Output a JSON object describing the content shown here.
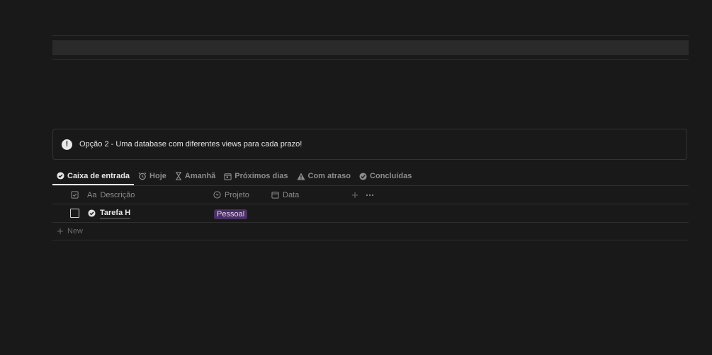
{
  "callout": {
    "text": "Opção 2 - Uma database com diferentes views para cada prazo!"
  },
  "tabs": [
    {
      "label": "Caixa de entrada",
      "icon": "check-circle-icon",
      "active": true
    },
    {
      "label": "Hoje",
      "icon": "alarm-clock-icon",
      "active": false
    },
    {
      "label": "Amanhã",
      "icon": "hourglass-icon",
      "active": false
    },
    {
      "label": "Próximos dias",
      "icon": "calendar-icon",
      "active": false
    },
    {
      "label": "Com atraso",
      "icon": "warning-icon",
      "active": false
    },
    {
      "label": "Concluídas",
      "icon": "check-circle-icon",
      "active": false
    }
  ],
  "table": {
    "columns": {
      "title_prefix": "Aa",
      "title": "Descrição",
      "project": "Projeto",
      "date": "Data"
    },
    "rows": [
      {
        "title": "Tarefa H",
        "project": "Pessoal",
        "project_color": "#492f64",
        "checked": false
      }
    ],
    "new_label": "New"
  }
}
